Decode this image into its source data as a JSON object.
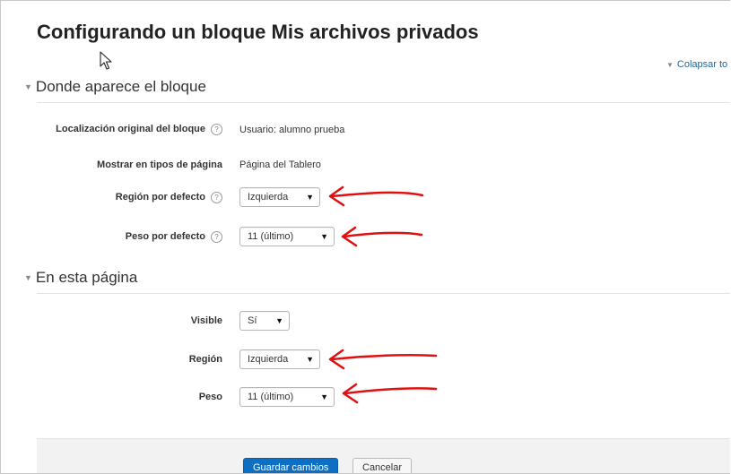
{
  "page": {
    "title": "Configurando un bloque Mis archivos privados",
    "collapse_all": "Colapsar to"
  },
  "sections": [
    {
      "legend": "Donde aparece el bloque",
      "fields": [
        {
          "label": "Localización original del bloque",
          "help": "?",
          "value": "Usuario: alumno prueba"
        },
        {
          "label": "Mostrar en tipos de página",
          "value": "Página del Tablero"
        },
        {
          "label": "Región por defecto",
          "help": "?",
          "value": "Izquierda"
        },
        {
          "label": "Peso por defecto",
          "help": "?",
          "value": "11 (último)"
        }
      ]
    },
    {
      "legend": "En esta página",
      "fields": [
        {
          "label": "Visible",
          "value": "Sí"
        },
        {
          "label": "Región",
          "value": "Izquierda"
        },
        {
          "label": "Peso",
          "value": "11 (último)"
        }
      ]
    }
  ],
  "buttons": {
    "save": "Guardar cambios",
    "cancel": "Cancelar"
  },
  "icons": {
    "help": "question-circle-icon",
    "collapse": "triangle-down-icon",
    "caret": "caret-down-icon",
    "cursor": "mouse-pointer-icon",
    "annotation": "red-arrow-icon"
  },
  "colors": {
    "primary_button": "#0e6fc2",
    "link": "#2a6496",
    "annotation": "#e01010"
  }
}
